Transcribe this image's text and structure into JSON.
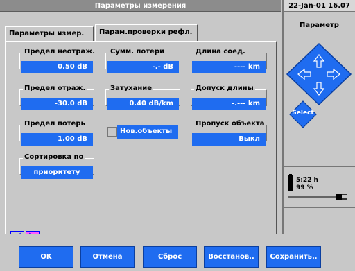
{
  "header": {
    "title": "Параметры измерения",
    "datetime": "22-Jan-01 16.07"
  },
  "tabs": [
    {
      "label": "Параметры измер."
    },
    {
      "label": "Парам.проверки рефл."
    }
  ],
  "fields": {
    "nonreflective_threshold": {
      "label": "Предел неотраж.",
      "value": "0.50 dB"
    },
    "total_loss": {
      "label": "Сумм. потери",
      "value": "-.- dB"
    },
    "connection_length": {
      "label": "Длина соед.",
      "value": "---- km"
    },
    "reflective_threshold": {
      "label": "Предел отраж.",
      "value": "-30.0 dB"
    },
    "attenuation": {
      "label": "Затухание",
      "value": "0.40 dB/km"
    },
    "length_tolerance": {
      "label": "Допуск длины",
      "value": "-.--- km"
    },
    "loss_threshold": {
      "label": "Предел потерь",
      "value": "1.00 dB"
    },
    "new_objects": {
      "label": "Нов.объекты"
    },
    "skip_object": {
      "label": "Пропуск объекта",
      "value": "Выкл"
    },
    "sort_by": {
      "label": "Сортировка по",
      "value": "приоритету"
    }
  },
  "right_panel": {
    "title": "Параметр",
    "select_label": "Select",
    "battery": {
      "time": "5:22 h",
      "percent": "99 %"
    }
  },
  "buttons": {
    "ok": "OK",
    "cancel": "Отмена",
    "reset": "Сброс",
    "restore": "Восстанов..",
    "save": "Сохранить.."
  },
  "colors": {
    "field_blue": "#1f6cf0",
    "nav_active": "#ff5cff",
    "dpad_blue": "#1f6cf0"
  },
  "icons": {
    "arrows": [
      "up-arrow-icon",
      "down-arrow-icon",
      "left-arrow-icon",
      "right-arrow-icon"
    ],
    "battery": "battery-icon",
    "plug": "power-plug-icon"
  }
}
